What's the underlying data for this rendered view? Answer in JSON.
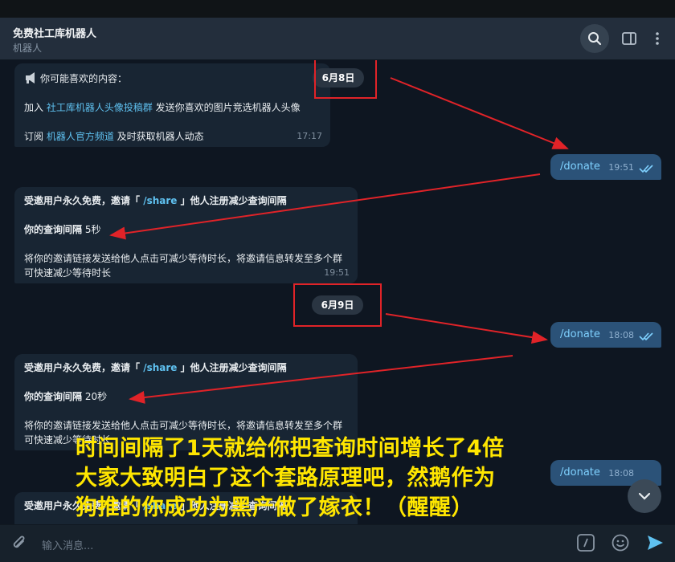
{
  "window": {
    "title": "免费社工库机器人",
    "subtitle": "机器人"
  },
  "messages": {
    "m1": {
      "line1_prefix": "你可能喜欢的内容：",
      "line2_prefix": "加入 ",
      "line2_link": "社工库机器人头像投稿群",
      "line2_suffix": " 发送你喜欢的图片竞选机器人头像",
      "line3_prefix": "订阅 ",
      "line3_link": "机器人官方频道",
      "line3_suffix": " 及时获取机器人动态",
      "time": "17:17"
    },
    "date1": "6月8日",
    "donate1": {
      "text": "/donate",
      "time": "19:51"
    },
    "m2": {
      "head_prefix": "受邀用户永久免费，邀请「 ",
      "head_link": "/share",
      "head_suffix": " 」他人注册减少查询间隔",
      "interval_label": "你的查询间隔",
      "interval_value": " 5秒",
      "desc": "将你的邀请链接发送给他人点击可减少等待时长，将邀请信息转发至多个群可快速减少等待时长",
      "time": "19:51"
    },
    "date2": "6月9日",
    "donate2": {
      "text": "/donate",
      "time": "18:08"
    },
    "m3": {
      "head_prefix": "受邀用户永久免费，邀请「 ",
      "head_link": "/share",
      "head_suffix": " 」他人注册减少查询间隔",
      "interval_label": "你的查询间隔",
      "interval_value": " 20秒",
      "desc": "将你的邀请链接发送给他人点击可减少等待时长，将邀请信息转发至多个群可快速减少等待时长"
    },
    "donate3": {
      "text": "/donate",
      "time": "18:08"
    },
    "m4": {
      "head_prefix": "受邀用户永久免费，邀请「 ",
      "head_link": "/share",
      "head_suffix": " 」他人注册减少查询间隔"
    }
  },
  "caption": {
    "line1": "时间间隔了1天就给你把查询时间增长了4倍",
    "line2": "大家大致明白了这个套路原理吧，然鹅作为",
    "line3": "狗推的你成功为黑产做了嫁衣！（醒醒）"
  },
  "composer": {
    "placeholder": "输入消息..."
  },
  "colors": {
    "accent": "#5fc1f0",
    "annotation_red": "#e02328",
    "caption_yellow": "#ffe600"
  },
  "icons": [
    "search-icon",
    "side-panel-icon",
    "more-icon",
    "megaphone-icon",
    "double-check-icon",
    "chevron-down-icon",
    "attach-icon",
    "command-icon",
    "emoji-icon",
    "send-icon"
  ]
}
